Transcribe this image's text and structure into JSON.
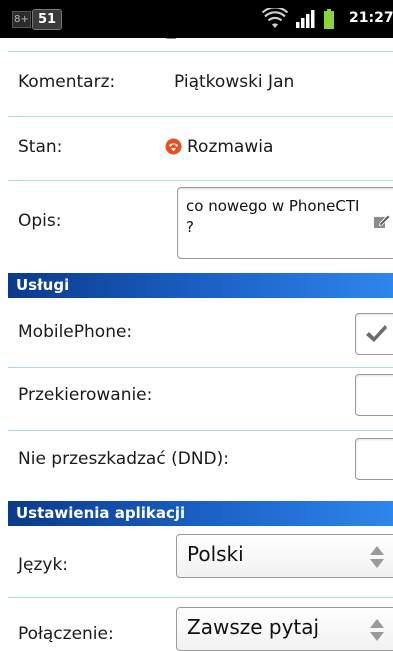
{
  "status_bar": {
    "plus_badge": "8+",
    "notification_count": "51",
    "time": "21:27",
    "icons": [
      "wifi-icon",
      "signal-icon",
      "battery-icon"
    ]
  },
  "contact": {
    "comment_label": "Komentarz:",
    "comment_value": "Piątkowski Jan",
    "state_label": "Stan:",
    "state_value": "Rozmawia",
    "state_icon": "busy-phone-icon",
    "description_label": "Opis:",
    "description_value": "co nowego w PhoneCTI ?"
  },
  "services": {
    "header": "Usługi",
    "items": [
      {
        "label": "MobilePhone:",
        "checked": true
      },
      {
        "label": "Przekierowanie:",
        "checked": false
      },
      {
        "label": "Nie przeszkadzać (DND):",
        "checked": false
      }
    ]
  },
  "app_settings": {
    "header": "Ustawienia aplikacji",
    "language_label": "Język:",
    "language_value": "Polski",
    "connection_label": "Połączenie:",
    "connection_value": "Zawsze pytaj"
  },
  "colors": {
    "divider": "#a8d8ec",
    "header_dark": "#0b3a8a",
    "header_light": "#2f86ec",
    "status_icon": "#e8501f"
  }
}
